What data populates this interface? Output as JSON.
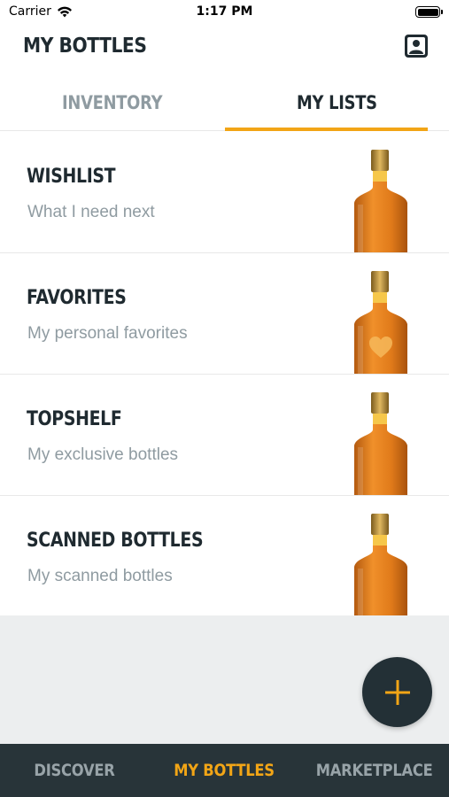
{
  "status_bar": {
    "carrier": "Carrier",
    "time": "1:17 PM"
  },
  "header": {
    "title": "MY BOTTLES",
    "profile_icon": "profile-card-icon"
  },
  "tabs": [
    {
      "label": "INVENTORY",
      "active": false
    },
    {
      "label": "MY LISTS",
      "active": true
    }
  ],
  "lists": [
    {
      "name": "WISHLIST",
      "description": "What I need next",
      "icon": "bottle-icon"
    },
    {
      "name": "FAVORITES",
      "description": "My personal favorites",
      "icon": "bottle-heart-icon"
    },
    {
      "name": "TOPSHELF",
      "description": "My exclusive bottles",
      "icon": "bottle-icon"
    },
    {
      "name": "SCANNED BOTTLES",
      "description": "My scanned bottles",
      "icon": "bottle-icon"
    }
  ],
  "fab": {
    "icon": "plus-icon"
  },
  "bottom_nav": [
    {
      "label": "DISCOVER",
      "active": false
    },
    {
      "label": "MY BOTTLES",
      "active": true
    },
    {
      "label": "MARKETPLACE",
      "active": false
    }
  ],
  "colors": {
    "accent": "#f2a516",
    "dark": "#283439",
    "muted": "#8f9ba1"
  }
}
